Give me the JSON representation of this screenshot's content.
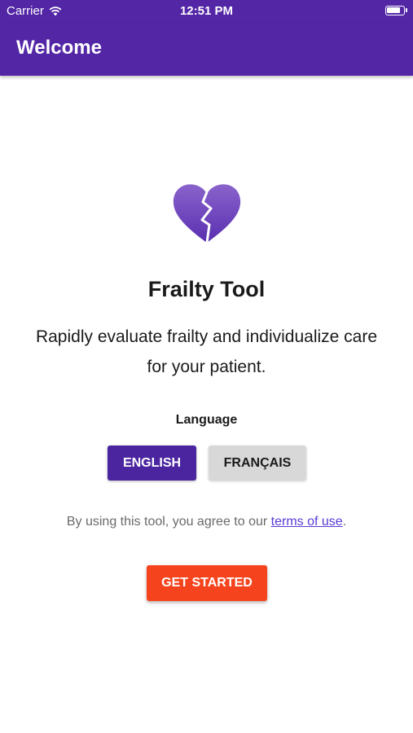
{
  "status_bar": {
    "carrier": "Carrier",
    "time": "12:51 PM",
    "wifi_icon": "wifi-icon",
    "battery_icon": "battery-icon"
  },
  "app_bar": {
    "title": "Welcome"
  },
  "main": {
    "logo_icon": "broken-heart-icon",
    "app_name": "Frailty Tool",
    "tagline": "Rapidly evaluate frailty and individualize care for your patient.",
    "language_label": "Language",
    "language_options": [
      "ENGLISH",
      "FRANÇAIS"
    ],
    "selected_language": "ENGLISH",
    "terms_prefix": "By using this tool, you agree to our ",
    "terms_link": "terms of use",
    "terms_suffix": ".",
    "get_started_label": "GET STARTED"
  },
  "colors": {
    "primary": "#5326a6",
    "selected_button": "#4b25a0",
    "unselected_button": "#d8d8d8",
    "accent": "#f5441d",
    "link": "#5b3ad6"
  }
}
